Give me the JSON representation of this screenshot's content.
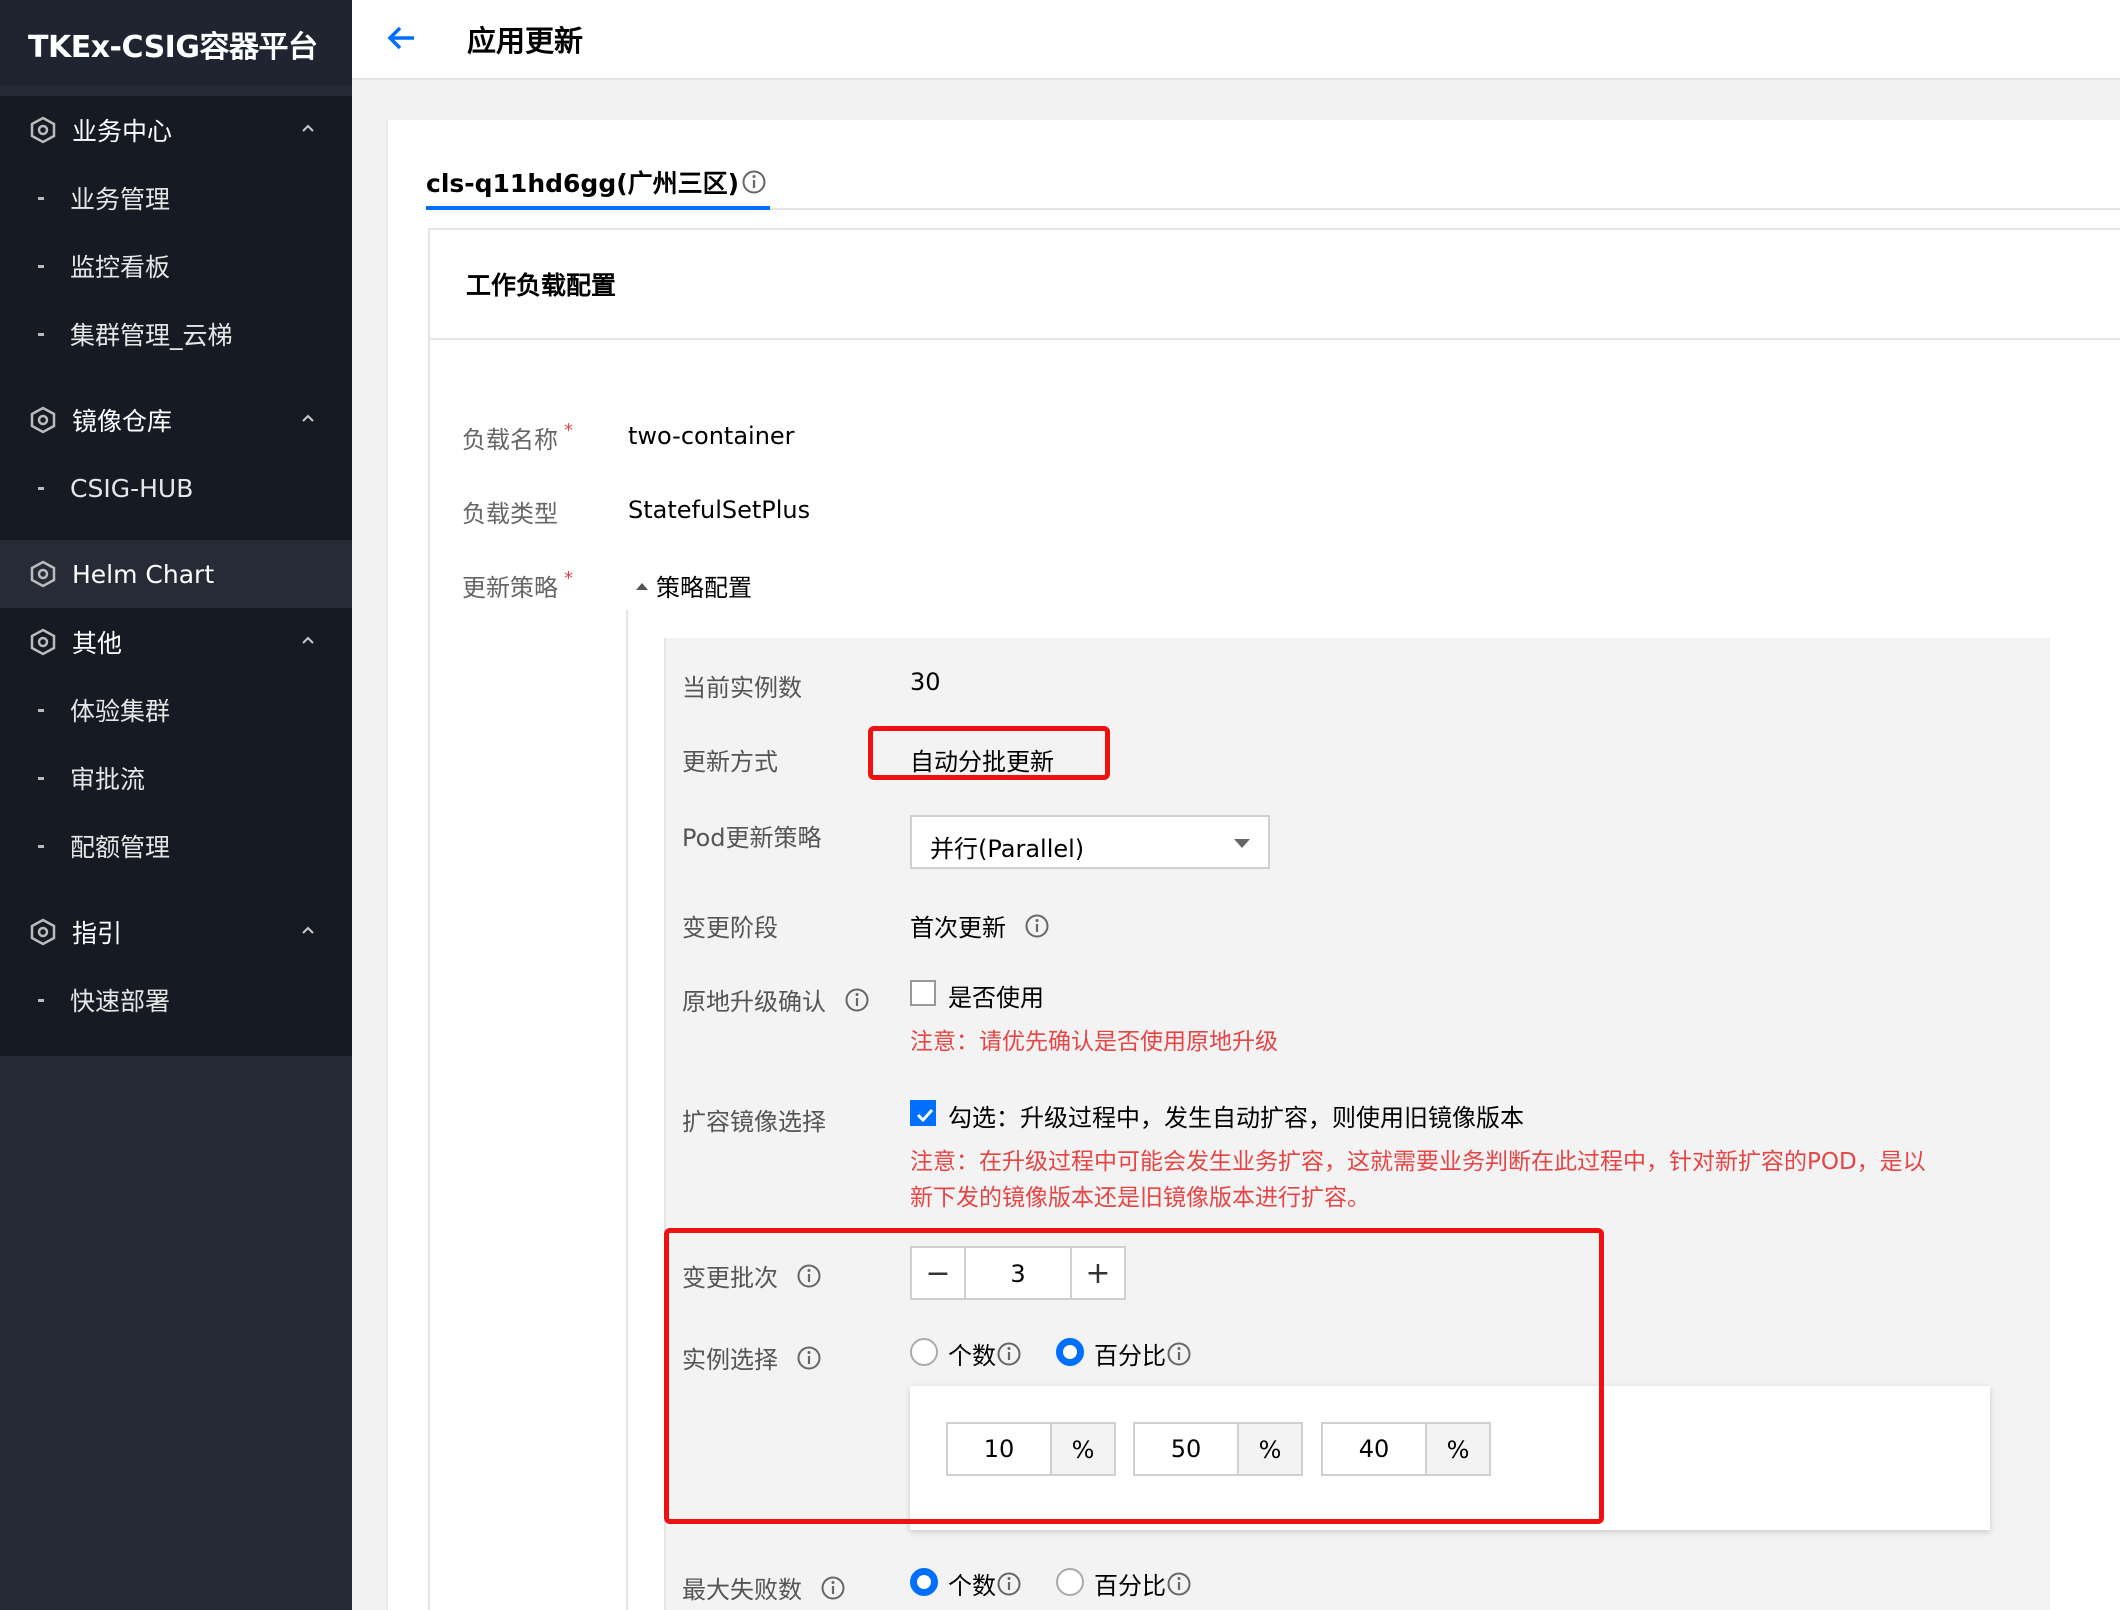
{
  "sidebar": {
    "brand": "TKEx-CSIG容器平台",
    "groups": [
      {
        "label": "业务中心",
        "items": [
          "业务管理",
          "监控看板",
          "集群管理_云梯"
        ]
      },
      {
        "label": "镜像仓库",
        "items": [
          "CSIG-HUB"
        ]
      },
      {
        "label": "Helm Chart",
        "items": []
      },
      {
        "label": "其他",
        "items": [
          "体验集群",
          "审批流",
          "配额管理"
        ]
      },
      {
        "label": "指引",
        "items": [
          "快速部署"
        ]
      }
    ]
  },
  "header": {
    "title": "应用更新"
  },
  "tab": {
    "label": "cls-q11hd6gg(广州三区)"
  },
  "panel": {
    "title": "工作负载配置"
  },
  "form": {
    "name_label": "负载名称",
    "name_value": "two-container",
    "type_label": "负载类型",
    "type_value": "StatefulSetPlus",
    "strategy_label": "更新策略",
    "strategy_toggle": "策略配置",
    "required_mark": "*"
  },
  "strategy": {
    "instances_label": "当前实例数",
    "instances_value": "30",
    "method_label": "更新方式",
    "method_value": "自动分批更新",
    "pod_policy_label": "Pod更新策略",
    "pod_policy_value": "并行(Parallel)",
    "stage_label": "变更阶段",
    "stage_value": "首次更新",
    "inplace_label": "原地升级确认",
    "inplace_option": "是否使用",
    "inplace_checked": false,
    "inplace_warning": "注意：请优先确认是否使用原地升级",
    "scale_label": "扩容镜像选择",
    "scale_option": "勾选：升级过程中，发生自动扩容，则使用旧镜像版本",
    "scale_checked": true,
    "scale_warning_line1": "注意：在升级过程中可能会发生业务扩容，这就需要业务判断在此过程中，针对新扩容的POD，是以",
    "scale_warning_line2": "新下发的镜像版本还是旧镜像版本进行扩容。",
    "batches_label": "变更批次",
    "batches_value": "3",
    "minus": "−",
    "plus": "+",
    "selection_label": "实例选择",
    "selection_opt_count": "个数",
    "selection_opt_percent": "百分比",
    "selection_selected": "百分比",
    "percentages": [
      "10",
      "50",
      "40"
    ],
    "percent_unit": "%",
    "maxfail_label": "最大失败数",
    "maxfail_opt_count": "个数",
    "maxfail_opt_percent": "百分比",
    "maxfail_selected": "个数"
  },
  "colors": {
    "accent": "#006eff",
    "warning": "#e54545",
    "highlight": "#ee1111",
    "sidebar_bg": "#161a22"
  }
}
